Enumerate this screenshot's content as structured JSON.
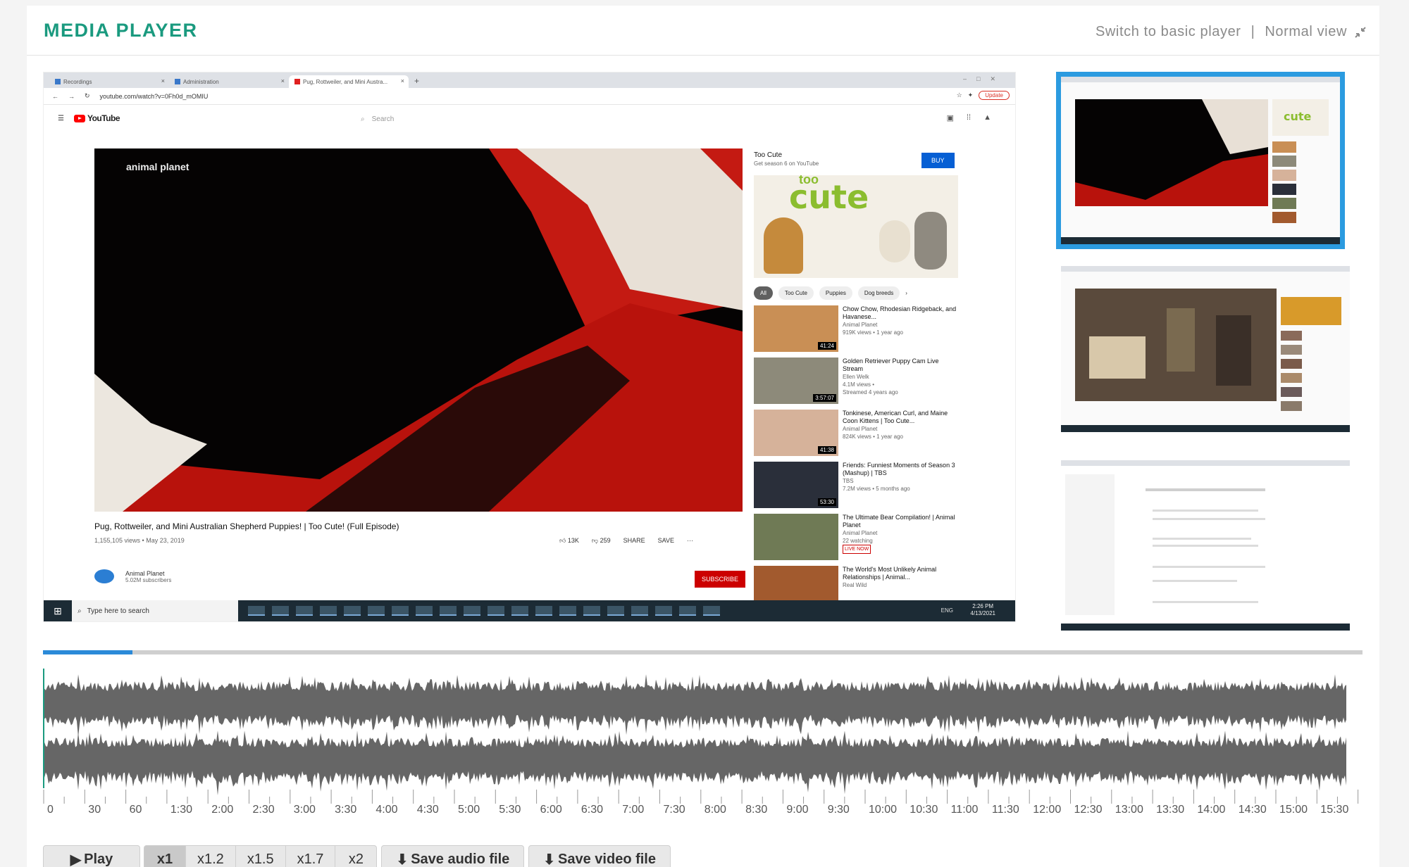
{
  "header": {
    "title": "MEDIA PLAYER",
    "switch_link": "Switch to basic player",
    "separator": "|",
    "view_link": "Normal view"
  },
  "browser": {
    "tabs": [
      {
        "label": "Recordings"
      },
      {
        "label": "Administration"
      },
      {
        "label": "Pug, Rottweiler, and Mini Austra..."
      }
    ],
    "new_tab": "+",
    "url": "youtube.com/watch?v=0Fh0d_mOMIU",
    "update_label": "Update"
  },
  "youtube": {
    "logo_text": "YouTube",
    "search_placeholder": "Search",
    "video_overlay": "animal planet",
    "video_title": "Pug, Rottweiler, and Mini Australian Shepherd Puppies! | Too Cute! (Full Episode)",
    "video_meta": "1,155,105 views • May 23, 2019",
    "actions": {
      "likes": "13K",
      "dislikes": "259",
      "share": "SHARE",
      "save": "SAVE",
      "more": "···"
    },
    "channel_name": "Animal Planet",
    "channel_subs": "5.02M subscribers",
    "subscribe": "SUBSCRIBE",
    "ad": {
      "title": "Too Cute",
      "subtitle": "Get season 6 on YouTube",
      "buy": "BUY",
      "logo": "cute",
      "logo_small": "too"
    },
    "chips": [
      "All",
      "Too Cute",
      "Puppies",
      "Dog breeds"
    ],
    "recommendations": [
      {
        "title": "Chow Chow, Rhodesian Ridgeback, and Havanese...",
        "channel": "Animal Planet",
        "meta": "919K views • 1 year ago",
        "duration": "41:24",
        "color": "#c98f55"
      },
      {
        "title": "Golden Retriever Puppy Cam Live Stream",
        "channel": "Ellen Welk",
        "meta": "4.1M views •",
        "meta2": "Streamed 4 years ago",
        "duration": "3:57:07",
        "color": "#8d8a7a"
      },
      {
        "title": "Tonkinese, American Curl, and Maine Coon Kittens | Too Cute...",
        "channel": "Animal Planet",
        "meta": "824K views • 1 year ago",
        "duration": "41:38",
        "color": "#d6b29a"
      },
      {
        "title": "Friends: Funniest Moments of Season 3 (Mashup) | TBS",
        "channel": "TBS",
        "meta": "7.2M views • 5 months ago",
        "duration": "53:30",
        "color": "#2a2f3a"
      },
      {
        "title": "The Ultimate Bear Compilation! | Animal Planet",
        "channel": "Animal Planet",
        "meta": "22 watching",
        "live": "LIVE NOW",
        "color": "#6f7a55"
      },
      {
        "title": "The World's Most Unlikely Animal Relationships | Animal...",
        "channel": "Real Wild",
        "meta": "",
        "color": "#a25a2e"
      }
    ]
  },
  "taskbar": {
    "search_placeholder": "Type here to search",
    "lang": "ENG",
    "time": "2:26 PM",
    "date": "4/13/2021"
  },
  "playback": {
    "progress_fraction": 0.068,
    "timeline_labels": [
      "0",
      "30",
      "60",
      "1:30",
      "2:00",
      "2:30",
      "3:00",
      "3:30",
      "4:00",
      "4:30",
      "5:00",
      "5:30",
      "6:00",
      "6:30",
      "7:00",
      "7:30",
      "8:00",
      "8:30",
      "9:00",
      "9:30",
      "10:00",
      "10:30",
      "11:00",
      "11:30",
      "12:00",
      "12:30",
      "13:00",
      "13:30",
      "14:00",
      "14:30",
      "15:00",
      "15:30"
    ]
  },
  "controls": {
    "play": "Play",
    "speeds": [
      "x1",
      "x1.2",
      "x1.5",
      "x1.7",
      "x2"
    ],
    "selected_speed": "x1",
    "save_audio": "Save audio file",
    "save_video": "Save video file"
  },
  "colors": {
    "accent": "#1a9a7f",
    "progress": "#2b8ad8",
    "waveform": "#666666",
    "thumb_selected": "#2b9be0"
  }
}
